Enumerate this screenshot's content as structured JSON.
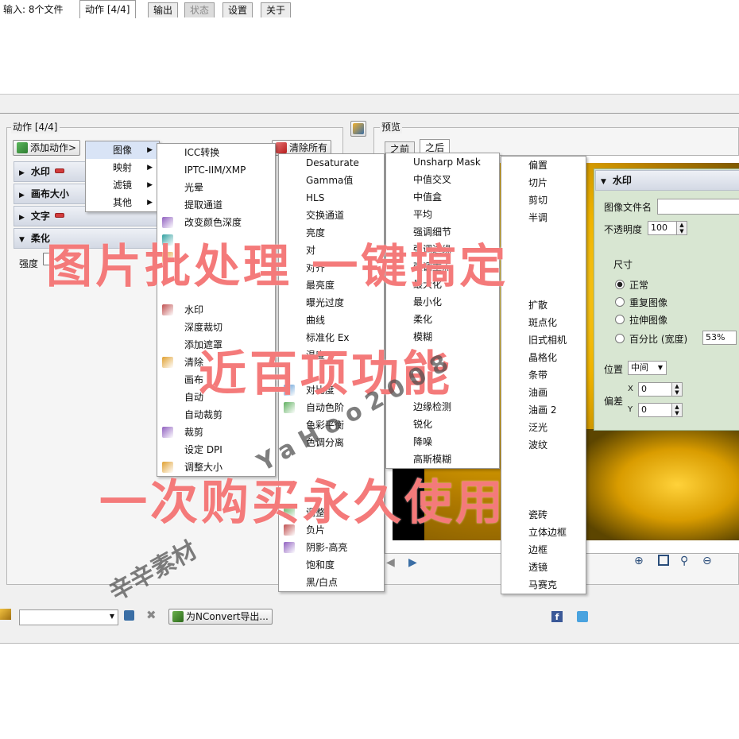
{
  "tabs": {
    "input_label": "输入: 8个文件",
    "items": [
      {
        "label": "动作 [4/4]"
      },
      {
        "label": "输出"
      },
      {
        "label": "状态"
      },
      {
        "label": "设置"
      },
      {
        "label": "关于"
      }
    ]
  },
  "actions": {
    "group_title": "动作 [4/4]",
    "add_button": "添加动作>",
    "clear_all": "清除所有",
    "rows": [
      {
        "label": "水印"
      },
      {
        "label": "画布大小"
      },
      {
        "label": "文字"
      },
      {
        "label": "柔化"
      }
    ],
    "strength_label": "强度"
  },
  "preview": {
    "title": "预览",
    "tab_before": "之前",
    "tab_after": "之后"
  },
  "menus": {
    "level0": [
      {
        "label": "图像"
      },
      {
        "label": "映射"
      },
      {
        "label": "滤镜"
      },
      {
        "label": "其他"
      }
    ],
    "image": [
      "ICC转换",
      "IPTC-IIM/XMP",
      "光晕",
      "提取通道",
      "改变颜色深度",
      "",
      "",
      "",
      "",
      "水印",
      "深度裁切",
      "添加遮罩",
      "清除",
      "画布",
      "自动",
      "自动裁剪",
      "裁剪",
      "设定 DPI",
      "调整大小"
    ],
    "map": [
      "Desaturate",
      "Gamma值",
      "HLS",
      "交换通道",
      "亮度",
      "对",
      "对齐",
      "最亮度",
      "曝光过度",
      "曲线",
      "标准化 Ex",
      "温度",
      "",
      "对比度",
      "自动色阶",
      "色彩平衡",
      "色调分离",
      "",
      "",
      "",
      "调整",
      "负片",
      "阴影-高亮",
      "饱和度",
      "黑/白点"
    ],
    "filter": [
      "Unsharp Mask",
      "中值交叉",
      "中值盒",
      "平均",
      "强调细节",
      "强调边缘",
      "强调重点",
      "最大化",
      "最小化",
      "柔化",
      "模糊",
      "",
      "",
      "",
      "边缘检测",
      "锐化",
      "降噪",
      "高斯模糊"
    ],
    "other": [
      "偏置",
      "切片",
      "剪切",
      "半调",
      "",
      "",
      "",
      "",
      "扩散",
      "斑点化",
      "旧式相机",
      "晶格化",
      "条带",
      "油画",
      "油画 2",
      "泛光",
      "波纹",
      "",
      "",
      "",
      "瓷砖",
      "立体边框",
      "边框",
      "透镜",
      "马赛克"
    ]
  },
  "watermark_panel": {
    "title": "水印",
    "file_label": "图像文件名",
    "opacity_label": "不透明度",
    "opacity_value": "100",
    "size_label": "尺寸",
    "options": [
      {
        "label": "正常",
        "selected": true
      },
      {
        "label": "重复图像",
        "selected": false
      },
      {
        "label": "拉伸图像",
        "selected": false
      },
      {
        "label": "百分比 (宽度)",
        "selected": false
      }
    ],
    "percent_value": "53%",
    "position_label": "位置",
    "position_value": "中间",
    "offset_label": "偏差",
    "x_label": "X",
    "x_value": "0",
    "y_label": "Y",
    "y_value": "0"
  },
  "bottom": {
    "export_button": "为NConvert导出..."
  },
  "overlay": {
    "line1": "图片批处理 一键搞定",
    "line2": "近百项功能",
    "line3": "一次购买永久使用",
    "wm1": "辛辛素材",
    "wm2": "YaHoo2008"
  },
  "colors": {
    "overlay_text": "#f47a7a",
    "header_bar": "#d3d9e4",
    "panel_bg": "#d8e6d2",
    "remove_icon": "#d23c3c"
  }
}
